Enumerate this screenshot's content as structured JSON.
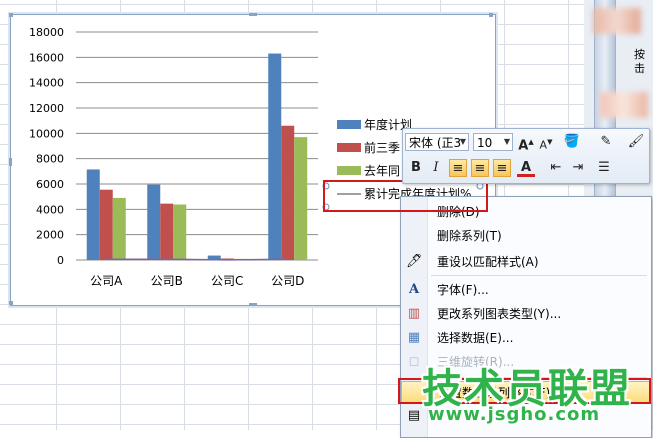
{
  "sidebar_text": "按\n击",
  "chart_data": {
    "type": "bar",
    "categories": [
      "公司A",
      "公司B",
      "公司C",
      "公司D"
    ],
    "series": [
      {
        "name": "年度计划",
        "values": [
          7150,
          5950,
          350,
          16300
        ],
        "color": "#4f81bd"
      },
      {
        "name": "前三季",
        "values": [
          5550,
          4450,
          120,
          10600
        ],
        "color": "#c0504d"
      },
      {
        "name": "去年同",
        "values": [
          4900,
          4380,
          90,
          9700
        ],
        "color": "#9bbb59"
      },
      {
        "name": "累计完成年度计划%",
        "values": [
          60,
          60,
          5,
          60
        ],
        "color": "#8064a2",
        "kind": "line"
      }
    ],
    "ylim": [
      0,
      18000
    ],
    "yticks": [
      "0",
      "2000",
      "4000",
      "6000",
      "8000",
      "10000",
      "12000",
      "14000",
      "16000",
      "18000"
    ]
  },
  "toolbar": {
    "font_name": "宋体 (正3",
    "font_size": "10",
    "grow_font": "A",
    "shrink_font": "A",
    "bold": "B",
    "italic": "I",
    "font_color_letter": "A"
  },
  "menu": {
    "items": [
      {
        "label": "删除(D)",
        "icon": "",
        "disabled": false
      },
      {
        "label": "删除系列(T)",
        "icon": "",
        "disabled": false
      },
      {
        "label": "重设以匹配样式(A)",
        "icon": "reset-style-icon",
        "disabled": false
      },
      {
        "label": "字体(F)...",
        "icon": "font-icon",
        "disabled": false
      },
      {
        "label": "更改系列图表类型(Y)...",
        "icon": "chart-type-icon",
        "disabled": false
      },
      {
        "label": "选择数据(E)...",
        "icon": "select-data-icon",
        "disabled": false
      },
      {
        "label": "三维旋转(R)...",
        "icon": "3d-rotation-icon",
        "disabled": true
      },
      {
        "label": "设置数据系列格式(F)...",
        "icon": "",
        "disabled": false
      },
      {
        "label": "",
        "icon": "format-icon",
        "disabled": false
      }
    ]
  },
  "watermark": {
    "title": "技术员联盟",
    "url": "www.jsgho.com"
  }
}
